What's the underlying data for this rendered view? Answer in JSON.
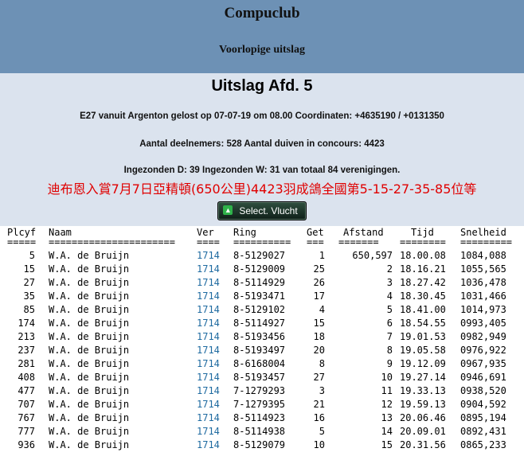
{
  "header": {
    "club": "Compuclub",
    "subtitle": "Voorlopige uitslag"
  },
  "info": {
    "title": "Uitslag Afd. 5",
    "line1": "E27 vanuit Argenton gelost op 07-07-19 om 08.00 Coordinaten: +4635190 / +0131350",
    "line2": "Aantal deelnemers: 528 Aantal duiven in concours: 4423",
    "line3": "Ingezonden D: 39 Ingezonden W: 31 van totaal 84 verenigingen.",
    "chinese_note": "迪布恩入賞7月7日亞精頓(650公里)4423羽成鴿全國第5-15-27-35-85位等",
    "button_label": "Select. Vlucht"
  },
  "table": {
    "headers": [
      "Plcyf",
      "Naam",
      "Ver",
      "Ring",
      "Get",
      "Afstand",
      "Tijd",
      "Snelheid"
    ],
    "separators": [
      "=====",
      "======================",
      "====",
      "==========",
      "===",
      "=======",
      "========",
      "========="
    ],
    "rows": [
      [
        "5",
        "W.A. de Bruijn",
        "1714",
        "8-5129027",
        "1",
        "650,597",
        "18.00.08",
        "1084,088"
      ],
      [
        "15",
        "W.A. de Bruijn",
        "1714",
        "8-5129009",
        "25",
        "2",
        "18.16.21",
        "1055,565"
      ],
      [
        "27",
        "W.A. de Bruijn",
        "1714",
        "8-5114929",
        "26",
        "3",
        "18.27.42",
        "1036,478"
      ],
      [
        "35",
        "W.A. de Bruijn",
        "1714",
        "8-5193471",
        "17",
        "4",
        "18.30.45",
        "1031,466"
      ],
      [
        "85",
        "W.A. de Bruijn",
        "1714",
        "8-5129102",
        "4",
        "5",
        "18.41.00",
        "1014,973"
      ],
      [
        "174",
        "W.A. de Bruijn",
        "1714",
        "8-5114927",
        "15",
        "6",
        "18.54.55",
        "0993,405"
      ],
      [
        "213",
        "W.A. de Bruijn",
        "1714",
        "8-5193456",
        "18",
        "7",
        "19.01.53",
        "0982,949"
      ],
      [
        "237",
        "W.A. de Bruijn",
        "1714",
        "8-5193497",
        "20",
        "8",
        "19.05.58",
        "0976,922"
      ],
      [
        "281",
        "W.A. de Bruijn",
        "1714",
        "8-6168004",
        "8",
        "9",
        "19.12.09",
        "0967,935"
      ],
      [
        "408",
        "W.A. de Bruijn",
        "1714",
        "8-5193457",
        "27",
        "10",
        "19.27.14",
        "0946,691"
      ],
      [
        "477",
        "W.A. de Bruijn",
        "1714",
        "7-1279293",
        "3",
        "11",
        "19.33.13",
        "0938,520"
      ],
      [
        "707",
        "W.A. de Bruijn",
        "1714",
        "7-1279395",
        "21",
        "12",
        "19.59.13",
        "0904,592"
      ],
      [
        "767",
        "W.A. de Bruijn",
        "1714",
        "8-5114923",
        "16",
        "13",
        "20.06.46",
        "0895,194"
      ],
      [
        "777",
        "W.A. de Bruijn",
        "1714",
        "8-5114938",
        "5",
        "14",
        "20.09.01",
        "0892,431"
      ],
      [
        "936",
        "W.A. de Bruijn",
        "1714",
        "8-5129079",
        "10",
        "15",
        "20.31.56",
        "0865,233"
      ]
    ]
  }
}
